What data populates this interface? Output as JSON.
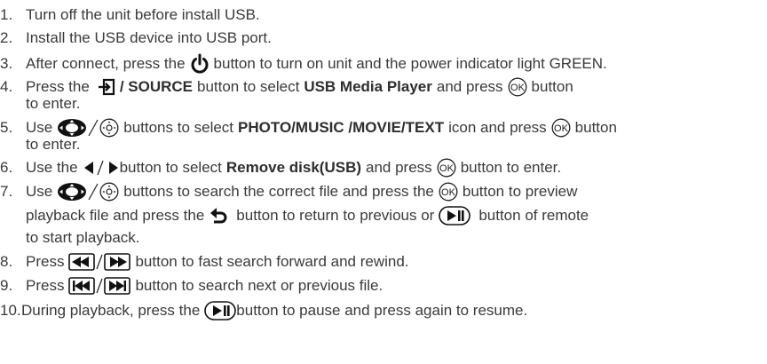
{
  "steps": [
    {
      "num": "1.",
      "text": "Turn off the unit before install USB."
    },
    {
      "num": "2.",
      "text": "Install the USB device into USB port."
    },
    {
      "num": "3.",
      "pre": "After connect, press the",
      "post": "button to turn on unit and the power indicator light GREEN."
    },
    {
      "num": "4.",
      "pre": "Press the",
      "source_label": "/ SOURCE",
      "mid1": "button to select",
      "target": "USB Media Player",
      "mid2": "and press",
      "post": "button",
      "cont": "to enter."
    },
    {
      "num": "5.",
      "pre": "Use",
      "mid1": "buttons to select",
      "target": "PHOTO/MUSIC /MOVIE/TEXT",
      "mid2": "icon and press",
      "post": "button",
      "cont": "to enter."
    },
    {
      "num": "6.",
      "pre": "Use the",
      "mid1": "button to select",
      "target": "Remove disk(USB)",
      "mid2": "and press",
      "post": "button to enter."
    },
    {
      "num": "7.",
      "pre": "Use",
      "mid1": "buttons to search the correct file and press the",
      "post": "button to preview",
      "cont1": "playback file and press the",
      "cont2": "button to return to previous or",
      "cont3": "button of remote",
      "cont4": "to start playback."
    },
    {
      "num": "8.",
      "pre": "Press",
      "post": "button to fast search forward and rewind."
    },
    {
      "num": "9.",
      "pre": "Press",
      "post": "button to search next or previous file."
    },
    {
      "num": "10.",
      "pre": "During playback, press the",
      "post": "button to pause and press again to resume."
    }
  ],
  "icons": {
    "power": "power-icon",
    "source": "source-input-icon",
    "ok": "ok-button-icon",
    "dpad": "dpad-navigation-icon",
    "joystick": "joystick-icon",
    "left_right": "left-right-arrow-icon",
    "back": "return-icon",
    "play_pause": "play-pause-icon",
    "rewind": "rewind-icon",
    "fast_forward": "fast-forward-icon",
    "prev": "previous-icon",
    "next": "next-icon"
  }
}
